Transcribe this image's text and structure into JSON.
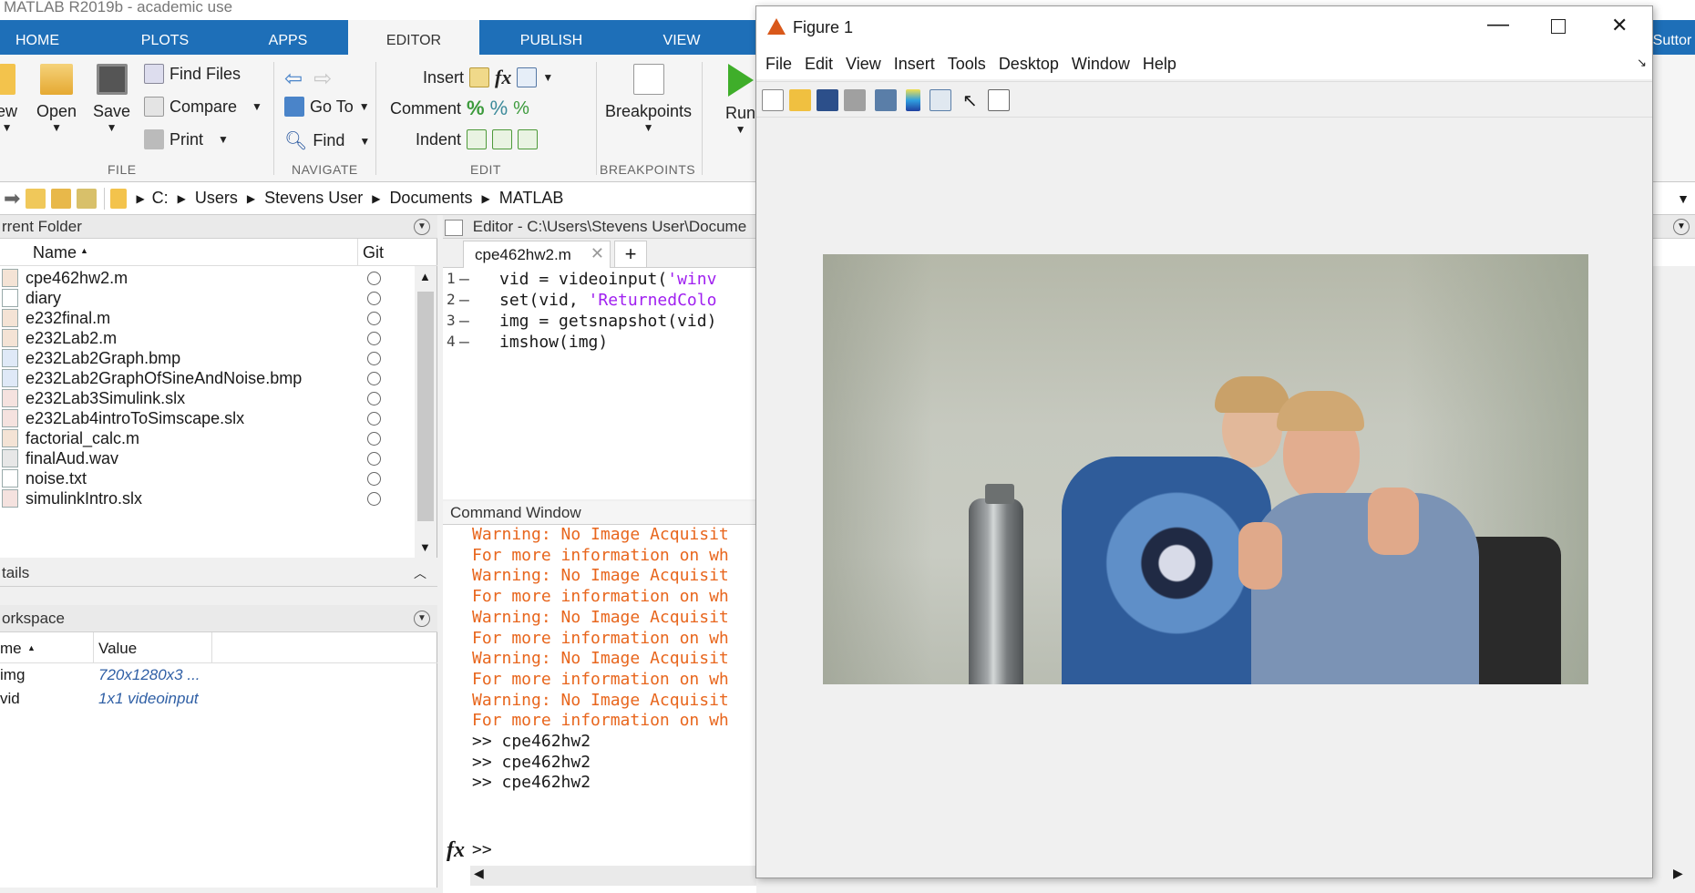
{
  "app": {
    "title": "MATLAB R2019b - academic use",
    "right_user": "Suttor"
  },
  "tabs": [
    "HOME",
    "PLOTS",
    "APPS",
    "EDITOR",
    "PUBLISH",
    "VIEW"
  ],
  "ribbon": {
    "file": {
      "new": "ew",
      "open": "Open",
      "save": "Save",
      "find_files": "Find Files",
      "compare": "Compare",
      "print": "Print",
      "label": "FILE"
    },
    "navigate": {
      "go_to": "Go To",
      "find": "Find",
      "label": "NAVIGATE"
    },
    "edit": {
      "insert": "Insert",
      "comment": "Comment",
      "indent": "Indent",
      "fx": "fx",
      "label": "EDIT"
    },
    "breakpoints": {
      "button": "Breakpoints",
      "label": "BREAKPOINTS"
    },
    "run": {
      "label": "Run"
    }
  },
  "address": [
    "C:",
    "Users",
    "Stevens User",
    "Documents",
    "MATLAB"
  ],
  "current_folder": {
    "title": "rrent Folder",
    "col_name": "Name",
    "col_git": "Git",
    "files": [
      "cpe462hw2.m",
      "diary",
      "e232final.m",
      "e232Lab2.m",
      "e232Lab2Graph.bmp",
      "e232Lab2GraphOfSineAndNoise.bmp",
      "e232Lab3Simulink.slx",
      "e232Lab4introToSimscape.slx",
      "factorial_calc.m",
      "finalAud.wav",
      "noise.txt",
      "simulinkIntro.slx"
    ]
  },
  "details": {
    "title": "tails"
  },
  "workspace": {
    "title": "orkspace",
    "col_name": "me",
    "col_value": "Value",
    "vars": [
      {
        "name": "img",
        "value": "720x1280x3 ..."
      },
      {
        "name": "vid",
        "value": "1x1 videoinput"
      }
    ]
  },
  "editor": {
    "title": "Editor - C:\\Users\\Stevens User\\Docume",
    "tab": "cpe462hw2.m",
    "lines": [
      {
        "num": "1",
        "pre": "vid = videoinput(",
        "str": "'winv"
      },
      {
        "num": "2",
        "pre": "set(vid, ",
        "str": "'ReturnedColo"
      },
      {
        "num": "3",
        "pre": "img = getsnapshot(vid)",
        "str": ""
      },
      {
        "num": "4",
        "pre": "imshow(img)",
        "str": ""
      }
    ]
  },
  "command_window": {
    "title": "Command Window",
    "lines": [
      {
        "text": "Warning: No Image Acquisit",
        "type": "warn"
      },
      {
        "text": "For more information on wh",
        "type": "warn"
      },
      {
        "text": "Warning: No Image Acquisit",
        "type": "warn"
      },
      {
        "text": "For more information on wh",
        "type": "warn"
      },
      {
        "text": "Warning: No Image Acquisit",
        "type": "warn"
      },
      {
        "text": "For more information on wh",
        "type": "warn"
      },
      {
        "text": "Warning: No Image Acquisit",
        "type": "warn"
      },
      {
        "text": "For more information on wh",
        "type": "warn"
      },
      {
        "text": "Warning: No Image Acquisit",
        "type": "warn"
      },
      {
        "text": "For more information on wh",
        "type": "warn"
      },
      {
        "text": ">> cpe462hw2",
        "type": "cmd"
      },
      {
        "text": ">> cpe462hw2",
        "type": "cmd"
      },
      {
        "text": ">> cpe462hw2",
        "type": "cmd"
      }
    ],
    "prompt": ">>",
    "fx": "fx"
  },
  "figure": {
    "title": "Figure 1",
    "menu": [
      "File",
      "Edit",
      "View",
      "Insert",
      "Tools",
      "Desktop",
      "Window",
      "Help"
    ]
  },
  "colors": {
    "tab_blue": "#1e6fb8",
    "warning": "#e8661d",
    "string": "#a020f0"
  }
}
